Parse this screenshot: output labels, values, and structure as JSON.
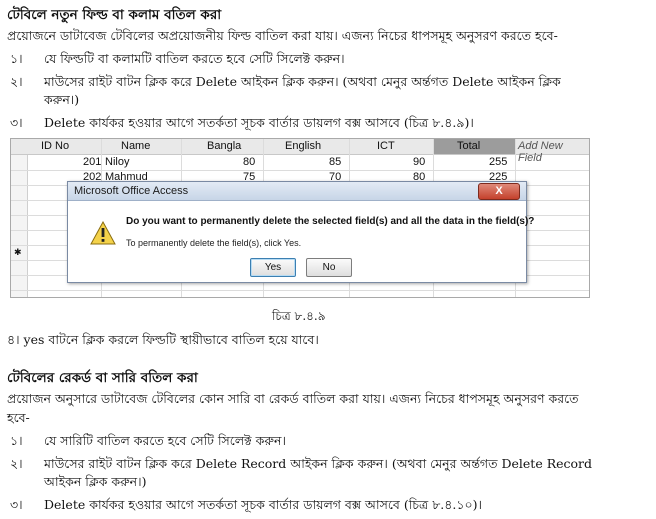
{
  "section1": {
    "heading": "টেবিলে নতুন ফিল্ড বা কলাম বতিল করা",
    "intro": "প্রয়োজনে ডাটাবেজ টেবিলের অপ্রয়োজনীয় ফিল্ড বাতিল করা যায়। এজন্য নিচের ধাপসমূহ অনুসরণ করতে হবে-",
    "steps": [
      {
        "num": "১।",
        "text": "যে ফিল্ডটি বা কলামটি বাতিল করতে হবে সেটি সিলেক্ট করুন।"
      },
      {
        "num": "২।",
        "text": "মাউসের রাইট বাটন ক্লিক করে Delete আইকন ক্লিক করুন। (অথবা মেনুর অর্ন্তগত Delete আইকন ক্লিক",
        "text2": "করুন।)"
      },
      {
        "num": "৩।",
        "text": "Delete কার্যকর হওয়ার আগে সতর্কতা সূচক বার্তার ডায়লগ বক্স আসবে (চিত্র ৮.৪.৯)।"
      }
    ]
  },
  "table": {
    "headers": [
      "ID No",
      "Name",
      "Bangla",
      "English",
      "ICT",
      "Total",
      "Add New Field"
    ],
    "rows": [
      [
        "201",
        "Niloy",
        "80",
        "85",
        "90",
        "255"
      ],
      [
        "202",
        "Mahmud",
        "75",
        "70",
        "80",
        "225"
      ]
    ],
    "new_row_marker": "✱"
  },
  "dialog": {
    "title": "Microsoft Office Access",
    "close": "X",
    "message": "Do you want to permanently delete the selected field(s) and all the data in the field(s)?",
    "sub": "To permanently delete the field(s), click Yes.",
    "yes": "Yes",
    "no": "No"
  },
  "caption1": "চিত্র ৮.৪.৯",
  "step4": "৪। yes বাটনে ক্লিক করলে ফিল্ডটি স্থায়ীভাবে বাতিল হয়ে যাবে।",
  "section2": {
    "heading": "টেবিলের রেকর্ড বা সারি বতিল করা",
    "intro1": "প্রয়োজন অনুসারে ডাটাবেজ টেবিলের কোন সারি বা রেকর্ড বাতিল করা যায়। এজন্য নিচের ধাপসমূহ অনুসরণ করতে",
    "intro2": "হবে-",
    "steps": [
      {
        "num": "১।",
        "text": "যে সারিটি বাতিল করতে হবে সেটি সিলেক্ট করুন।"
      },
      {
        "num": "২।",
        "text": "মাউসের রাইট বাটন ক্লিক করে Delete Record আইকন ক্লিক করুন। (অথবা মেনুর অর্ন্তগত Delete Record",
        "text2": "আইকন ক্লিক করুন।)"
      },
      {
        "num": "৩।",
        "text": "Delete কার্যকর হওয়ার আগে সতর্কতা সূচক বার্তার ডায়লগ বক্স আসবে (চিত্র ৮.৪.১০)।"
      }
    ]
  }
}
